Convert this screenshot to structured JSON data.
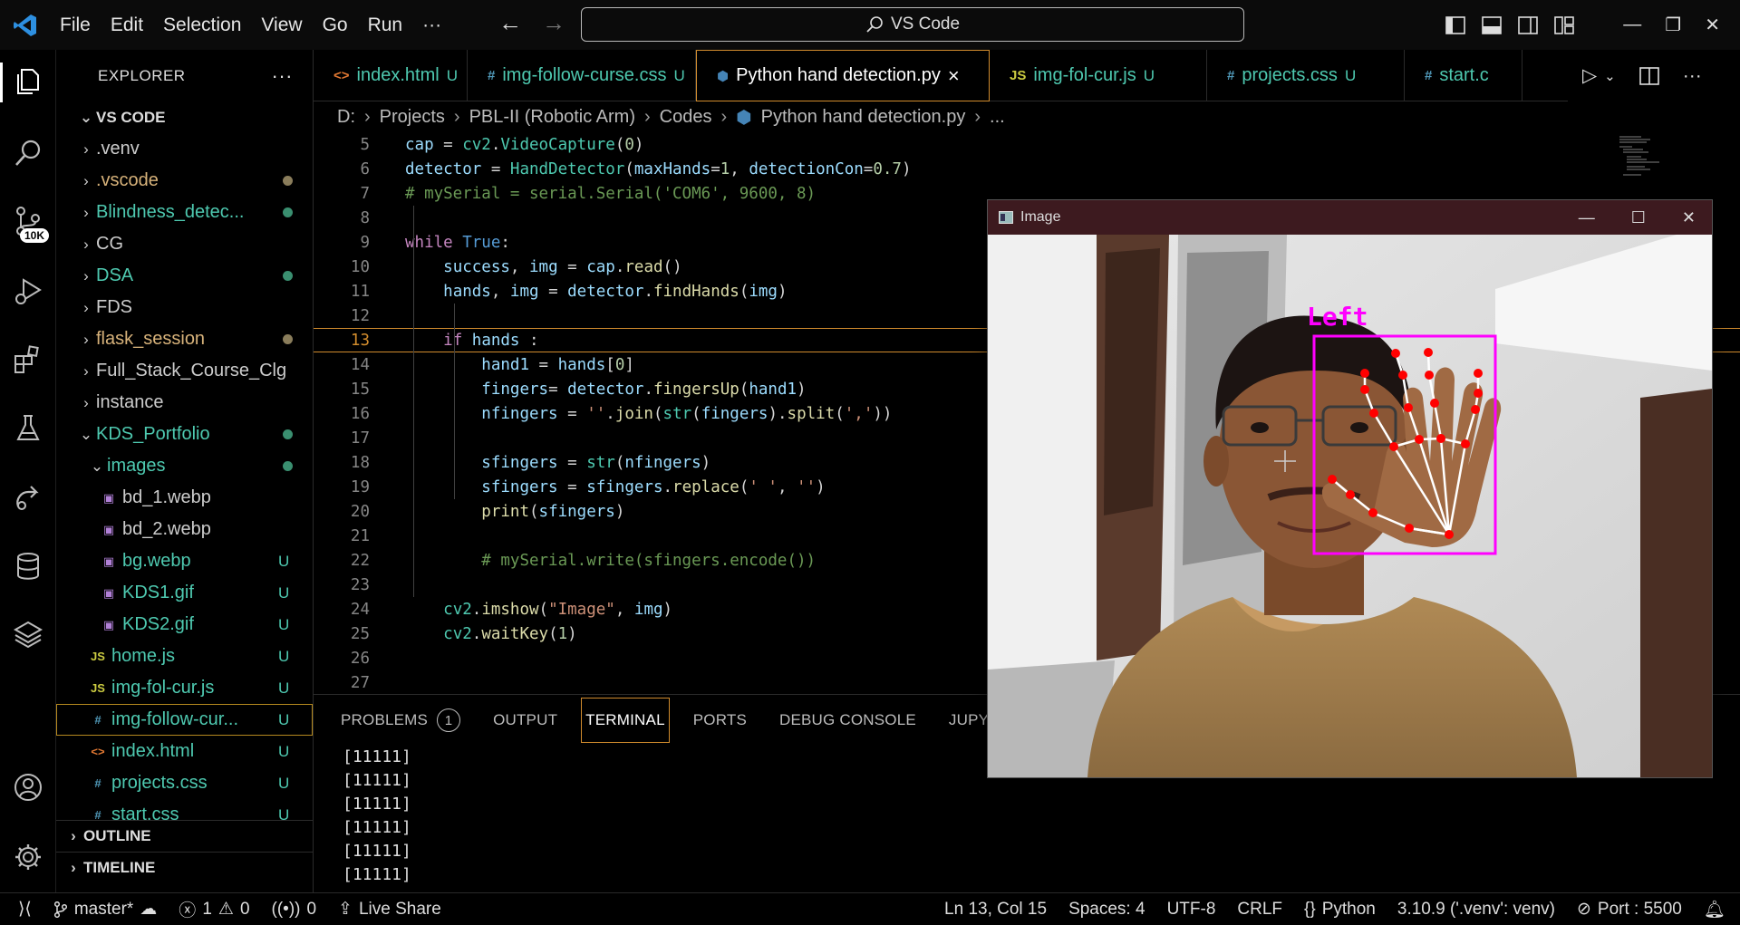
{
  "menu": [
    "File",
    "Edit",
    "Selection",
    "View",
    "Go",
    "Run",
    "···"
  ],
  "command_center": "VS Code",
  "activity": {
    "badge": "10K"
  },
  "explorer": {
    "title": "EXPLORER",
    "root": "VS CODE",
    "items": [
      {
        "label": ".venv",
        "type": "folder",
        "color": "#cccccc",
        "status": ""
      },
      {
        "label": ".vscode",
        "type": "folder",
        "color": "#d7b27a",
        "status": "dot-tan"
      },
      {
        "label": "Blindness_detec...",
        "type": "folder",
        "color": "#4ec9b0",
        "status": "dot-green"
      },
      {
        "label": "CG",
        "type": "folder",
        "color": "#cccccc",
        "status": ""
      },
      {
        "label": "DSA",
        "type": "folder",
        "color": "#4ec9b0",
        "status": "dot-green"
      },
      {
        "label": "FDS",
        "type": "folder",
        "color": "#cccccc",
        "status": ""
      },
      {
        "label": "flask_session",
        "type": "folder",
        "color": "#d7b27a",
        "status": "dot-tan"
      },
      {
        "label": "Full_Stack_Course_Clg",
        "type": "folder",
        "color": "#cccccc",
        "status": ""
      },
      {
        "label": "instance",
        "type": "folder",
        "color": "#cccccc",
        "status": ""
      },
      {
        "label": "KDS_Portfolio",
        "type": "folder-open",
        "color": "#4ec9b0",
        "status": "dot-green"
      },
      {
        "label": "images",
        "type": "folder-open",
        "color": "#4ec9b0",
        "status": "dot-green",
        "indent": 1
      },
      {
        "label": "bd_1.webp",
        "type": "image",
        "color": "#cccccc",
        "status": "",
        "indent": 2
      },
      {
        "label": "bd_2.webp",
        "type": "image",
        "color": "#cccccc",
        "status": "",
        "indent": 2
      },
      {
        "label": "bg.webp",
        "type": "image",
        "color": "#4ec9b0",
        "status": "U",
        "indent": 2
      },
      {
        "label": "KDS1.gif",
        "type": "image",
        "color": "#4ec9b0",
        "status": "U",
        "indent": 2
      },
      {
        "label": "KDS2.gif",
        "type": "image",
        "color": "#4ec9b0",
        "status": "U",
        "indent": 2
      },
      {
        "label": "home.js",
        "type": "js",
        "color": "#4ec9b0",
        "status": "U",
        "indent": 1
      },
      {
        "label": "img-fol-cur.js",
        "type": "js",
        "color": "#4ec9b0",
        "status": "U",
        "indent": 1
      },
      {
        "label": "img-follow-cur...",
        "type": "css",
        "color": "#4ec9b0",
        "status": "U",
        "indent": 1,
        "selected": true
      },
      {
        "label": "index.html",
        "type": "html",
        "color": "#4ec9b0",
        "status": "U",
        "indent": 1
      },
      {
        "label": "projects.css",
        "type": "css",
        "color": "#4ec9b0",
        "status": "U",
        "indent": 1
      },
      {
        "label": "start.css",
        "type": "css",
        "color": "#4ec9b0",
        "status": "U",
        "indent": 1
      }
    ],
    "outline": "OUTLINE",
    "timeline": "TIMELINE"
  },
  "tabs": [
    {
      "icon": "<>",
      "label": "index.html",
      "badge": "U",
      "width": 170,
      "active": false,
      "iconColor": "#e37933"
    },
    {
      "icon": "#",
      "label": "img-follow-curse.css",
      "badge": "U",
      "width": 252,
      "active": false,
      "iconColor": "#519aba"
    },
    {
      "icon": "py",
      "label": "Python hand detection.py",
      "badge": "×",
      "width": 324,
      "active": true,
      "iconColor": "#4584b6"
    },
    {
      "icon": "JS",
      "label": "img-fol-cur.js",
      "badge": "U",
      "width": 240,
      "active": false,
      "iconColor": "#cbcb41"
    },
    {
      "icon": "#",
      "label": "projects.css",
      "badge": "U",
      "width": 218,
      "active": false,
      "iconColor": "#519aba"
    },
    {
      "icon": "#",
      "label": "start.c",
      "badge": "",
      "width": 130,
      "active": false,
      "iconColor": "#519aba"
    }
  ],
  "breadcrumb": [
    "D:",
    "Projects",
    "PBL-II (Robotic Arm)",
    "Codes",
    "Python hand detection.py",
    "..."
  ],
  "code": [
    {
      "n": "5",
      "t": [
        [
          "var",
          "cap"
        ],
        [
          "pl",
          " = "
        ],
        [
          "cls",
          "cv2"
        ],
        [
          "pl",
          "."
        ],
        [
          "cls",
          "VideoCapture"
        ],
        [
          "pl",
          "("
        ],
        [
          "num",
          "0"
        ],
        [
          "pl",
          ")"
        ]
      ]
    },
    {
      "n": "6",
      "t": [
        [
          "var",
          "detector"
        ],
        [
          "pl",
          " = "
        ],
        [
          "cls",
          "HandDetector"
        ],
        [
          "pl",
          "("
        ],
        [
          "var",
          "maxHands"
        ],
        [
          "pl",
          "="
        ],
        [
          "num",
          "1"
        ],
        [
          "pl",
          ", "
        ],
        [
          "var",
          "detectionCon"
        ],
        [
          "pl",
          "="
        ],
        [
          "num",
          "0.7"
        ],
        [
          "pl",
          ")"
        ]
      ]
    },
    {
      "n": "7",
      "t": [
        [
          "cm",
          "# mySerial = serial.Serial('COM6', 9600, 8)"
        ]
      ]
    },
    {
      "n": "8",
      "t": []
    },
    {
      "n": "9",
      "t": [
        [
          "kw",
          "while"
        ],
        [
          "pl",
          " "
        ],
        [
          "bl",
          "True"
        ],
        [
          "pl",
          ":"
        ]
      ]
    },
    {
      "n": "10",
      "t": [
        [
          "pl",
          "    "
        ],
        [
          "var",
          "success"
        ],
        [
          "pl",
          ", "
        ],
        [
          "var",
          "img"
        ],
        [
          "pl",
          " = "
        ],
        [
          "var",
          "cap"
        ],
        [
          "pl",
          "."
        ],
        [
          "fn",
          "read"
        ],
        [
          "pl",
          "()"
        ]
      ]
    },
    {
      "n": "11",
      "t": [
        [
          "pl",
          "    "
        ],
        [
          "var",
          "hands"
        ],
        [
          "pl",
          ", "
        ],
        [
          "var",
          "img"
        ],
        [
          "pl",
          " = "
        ],
        [
          "var",
          "detector"
        ],
        [
          "pl",
          "."
        ],
        [
          "fn",
          "findHands"
        ],
        [
          "pl",
          "("
        ],
        [
          "var",
          "img"
        ],
        [
          "pl",
          ")"
        ]
      ]
    },
    {
      "n": "12",
      "t": []
    },
    {
      "n": "13",
      "t": [
        [
          "pl",
          "    "
        ],
        [
          "kw",
          "if"
        ],
        [
          "pl",
          " "
        ],
        [
          "var",
          "hands"
        ],
        [
          "pl",
          " :"
        ]
      ],
      "hl": true
    },
    {
      "n": "14",
      "t": [
        [
          "pl",
          "        "
        ],
        [
          "var",
          "hand1"
        ],
        [
          "pl",
          " = "
        ],
        [
          "var",
          "hands"
        ],
        [
          "pl",
          "["
        ],
        [
          "num",
          "0"
        ],
        [
          "pl",
          "]"
        ]
      ]
    },
    {
      "n": "15",
      "t": [
        [
          "pl",
          "        "
        ],
        [
          "var",
          "fingers"
        ],
        [
          "pl",
          "= "
        ],
        [
          "var",
          "detector"
        ],
        [
          "pl",
          "."
        ],
        [
          "fn",
          "fingersUp"
        ],
        [
          "pl",
          "("
        ],
        [
          "var",
          "hand1"
        ],
        [
          "pl",
          ")"
        ]
      ]
    },
    {
      "n": "16",
      "t": [
        [
          "pl",
          "        "
        ],
        [
          "var",
          "nfingers"
        ],
        [
          "pl",
          " = "
        ],
        [
          "str",
          "''"
        ],
        [
          "pl",
          "."
        ],
        [
          "fn",
          "join"
        ],
        [
          "pl",
          "("
        ],
        [
          "cls",
          "str"
        ],
        [
          "pl",
          "("
        ],
        [
          "var",
          "fingers"
        ],
        [
          "pl",
          ")."
        ],
        [
          "fn",
          "split"
        ],
        [
          "pl",
          "("
        ],
        [
          "str",
          "','"
        ],
        [
          "pl",
          "))"
        ]
      ]
    },
    {
      "n": "17",
      "t": []
    },
    {
      "n": "18",
      "t": [
        [
          "pl",
          "        "
        ],
        [
          "var",
          "sfingers"
        ],
        [
          "pl",
          " = "
        ],
        [
          "cls",
          "str"
        ],
        [
          "pl",
          "("
        ],
        [
          "var",
          "nfingers"
        ],
        [
          "pl",
          ")"
        ]
      ]
    },
    {
      "n": "19",
      "t": [
        [
          "pl",
          "        "
        ],
        [
          "var",
          "sfingers"
        ],
        [
          "pl",
          " = "
        ],
        [
          "var",
          "sfingers"
        ],
        [
          "pl",
          "."
        ],
        [
          "fn",
          "replace"
        ],
        [
          "pl",
          "("
        ],
        [
          "str",
          "' '"
        ],
        [
          "pl",
          ", "
        ],
        [
          "str",
          "''"
        ],
        [
          "pl",
          ")"
        ]
      ]
    },
    {
      "n": "20",
      "t": [
        [
          "pl",
          "        "
        ],
        [
          "fn",
          "print"
        ],
        [
          "pl",
          "("
        ],
        [
          "var",
          "sfingers"
        ],
        [
          "pl",
          ")"
        ]
      ]
    },
    {
      "n": "21",
      "t": []
    },
    {
      "n": "22",
      "t": [
        [
          "pl",
          "        "
        ],
        [
          "cm",
          "# mySerial.write(sfingers.encode())"
        ]
      ]
    },
    {
      "n": "23",
      "t": []
    },
    {
      "n": "24",
      "t": [
        [
          "pl",
          "    "
        ],
        [
          "cls",
          "cv2"
        ],
        [
          "pl",
          "."
        ],
        [
          "fn",
          "imshow"
        ],
        [
          "pl",
          "("
        ],
        [
          "str",
          "\"Image\""
        ],
        [
          "pl",
          ", "
        ],
        [
          "var",
          "img"
        ],
        [
          "pl",
          ")"
        ]
      ]
    },
    {
      "n": "25",
      "t": [
        [
          "pl",
          "    "
        ],
        [
          "cls",
          "cv2"
        ],
        [
          "pl",
          "."
        ],
        [
          "fn",
          "waitKey"
        ],
        [
          "pl",
          "("
        ],
        [
          "num",
          "1"
        ],
        [
          "pl",
          ")"
        ]
      ]
    },
    {
      "n": "26",
      "t": []
    },
    {
      "n": "27",
      "t": []
    }
  ],
  "panel": {
    "tabs": [
      {
        "label": "PROBLEMS",
        "badge": "1"
      },
      {
        "label": "OUTPUT"
      },
      {
        "label": "TERMINAL",
        "active": true
      },
      {
        "label": "PORTS"
      },
      {
        "label": "DEBUG CONSOLE"
      },
      {
        "label": "JUPYTER"
      }
    ],
    "terminal": [
      "[11111]",
      "[11111]",
      "[11111]",
      "[11111]",
      "[11111]",
      "[11111]"
    ]
  },
  "image_window": {
    "title": "Image",
    "hand_label": "Left"
  },
  "status": {
    "branch": "master*",
    "errors": "1",
    "warnings": "0",
    "ports_count": "0",
    "live_share": "Live Share",
    "position": "Ln 13, Col 15",
    "spaces": "Spaces: 4",
    "encoding": "UTF-8",
    "eol": "CRLF",
    "language": "Python",
    "interpreter": "3.10.9 ('.venv': venv)",
    "port": "Port : 5500"
  }
}
